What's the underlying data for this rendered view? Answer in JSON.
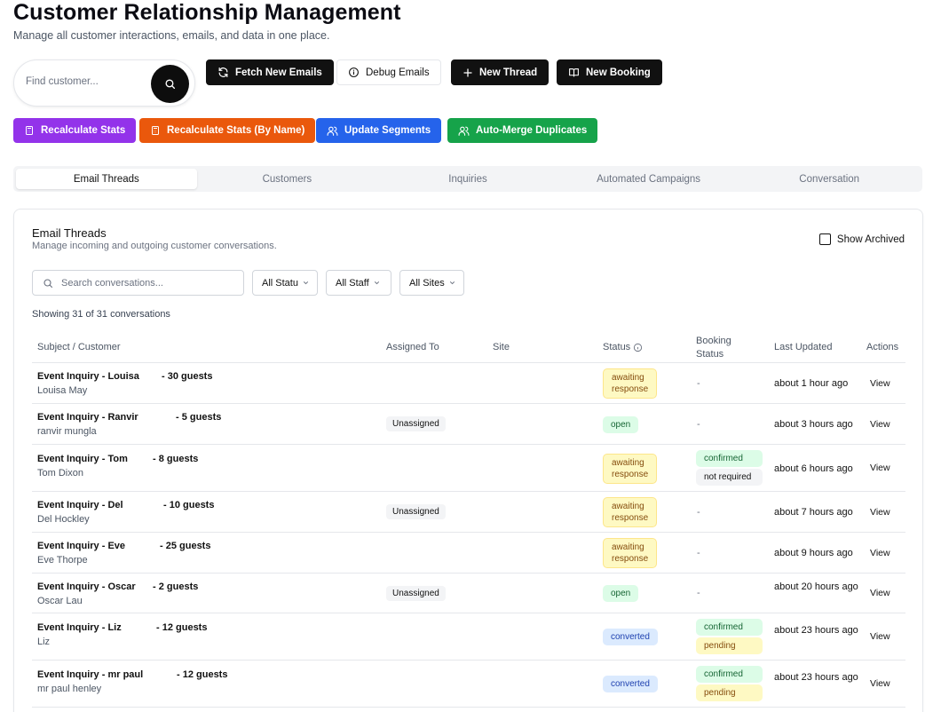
{
  "header": {
    "title": "Customer Relationship Management",
    "subtitle": "Manage all customer interactions, emails, and data in one place."
  },
  "find_customer": {
    "placeholder": "Find customer...",
    "icon": "search-icon"
  },
  "toolbar": {
    "fetch_emails": "Fetch New Emails",
    "debug_emails": "Debug Emails",
    "new_thread": "New Thread",
    "new_booking": "New Booking",
    "recalculate_stats": "Recalculate Stats",
    "recalculate_stats_by_name": "Recalculate Stats (By Name)",
    "update_segments": "Update Segments",
    "auto_merge": "Auto-Merge Duplicates"
  },
  "colors": {
    "purple": "#9333ea",
    "orange": "#ea580c",
    "blue": "#2563eb",
    "green": "#16a34a"
  },
  "tabs": [
    "Email Threads",
    "Customers",
    "Inquiries",
    "Automated Campaigns",
    "Conversation"
  ],
  "threads": {
    "title": "Email Threads",
    "description": "Manage incoming and outgoing customer conversations.",
    "show_archived": "Show Archived",
    "search_placeholder": "Search conversations...",
    "filters": {
      "status": "All Statu",
      "staff": "All Staff",
      "sites": "All Sites"
    },
    "showing": "Showing 31 of 31 conversations",
    "columns": {
      "subject": "Subject / Customer",
      "assigned": "Assigned To",
      "site": "Site",
      "status": "Status",
      "booking_line1": "Booking",
      "booking_line2": "Status",
      "updated": "Last Updated",
      "actions": "Actions"
    },
    "rows": [
      {
        "subject": "Event Inquiry - Louisa",
        "guests": "- 30 guests",
        "customer": "Louisa May",
        "assigned": "",
        "status": [
          "awaiting",
          "response"
        ],
        "booking": [],
        "updated": "about 1 hour ago",
        "action": "View"
      },
      {
        "subject": "Event Inquiry - Ranvir",
        "guests": "- 5 guests",
        "customer": "ranvir mungla",
        "assigned": "Unassigned",
        "status": [
          "open"
        ],
        "booking": [],
        "updated": "about 3 hours ago",
        "action": "View"
      },
      {
        "subject": "Event Inquiry - Tom",
        "guests": "- 8 guests",
        "customer": "Tom Dixon",
        "assigned": "",
        "status": [
          "awaiting",
          "response"
        ],
        "booking": [
          "confirmed",
          "not required"
        ],
        "updated": "about 6 hours ago",
        "action": "View"
      },
      {
        "subject": "Event Inquiry - Del",
        "guests": "- 10 guests",
        "customer": "Del Hockley",
        "assigned": "Unassigned",
        "status": [
          "awaiting",
          "response"
        ],
        "booking": [],
        "updated": "about 7 hours ago",
        "action": "View"
      },
      {
        "subject": "Event Inquiry - Eve",
        "guests": "- 25 guests",
        "customer": "Eve Thorpe",
        "assigned": "",
        "status": [
          "awaiting",
          "response"
        ],
        "booking": [],
        "updated": "about 9 hours ago",
        "action": "View"
      },
      {
        "subject": "Event Inquiry - Oscar",
        "guests": "- 2 guests",
        "customer": "Oscar Lau",
        "assigned": "Unassigned",
        "status": [
          "open"
        ],
        "booking": [],
        "updated": "about 20 hours ago",
        "action": "View"
      },
      {
        "subject": "Event Inquiry - Liz",
        "guests": "- 12 guests",
        "customer": "Liz",
        "assigned": "",
        "status": [
          "converted"
        ],
        "booking": [
          "confirmed",
          "pending"
        ],
        "updated": "about 23 hours ago",
        "action": "View"
      },
      {
        "subject": "Event Inquiry - mr paul",
        "guests": "- 12 guests",
        "customer": "mr paul henley",
        "assigned": "",
        "status": [
          "converted"
        ],
        "booking": [
          "confirmed",
          "pending"
        ],
        "updated": "about 23 hours ago",
        "action": "View"
      }
    ],
    "empty_booking": "-"
  }
}
